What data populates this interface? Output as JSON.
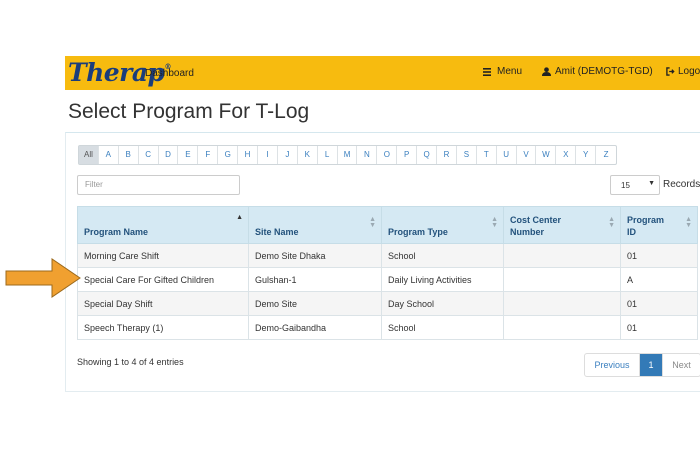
{
  "header": {
    "logo": "Therap",
    "logo_reg": "®",
    "dashboard_label": "Dashboard",
    "menu_label": "Menu",
    "user_label": "Amit (DEMOTG-TGD)",
    "logout_label": "Logo"
  },
  "page": {
    "title": "Select Program For T-Log"
  },
  "alphabet": [
    "All",
    "A",
    "B",
    "C",
    "D",
    "E",
    "F",
    "G",
    "H",
    "I",
    "J",
    "K",
    "L",
    "M",
    "N",
    "O",
    "P",
    "Q",
    "R",
    "S",
    "T",
    "U",
    "V",
    "W",
    "X",
    "Y",
    "Z"
  ],
  "filter": {
    "placeholder": "Filter"
  },
  "records": {
    "value": "15",
    "label": "Records"
  },
  "table": {
    "headers": [
      {
        "line1": "",
        "line2": "Program Name"
      },
      {
        "line1": "",
        "line2": "Site Name"
      },
      {
        "line1": "",
        "line2": "Program Type"
      },
      {
        "line1": "Cost Center",
        "line2": "Number"
      },
      {
        "line1": "Program",
        "line2": "ID"
      }
    ],
    "rows": [
      [
        "Morning Care Shift",
        "Demo Site Dhaka",
        "School",
        "",
        "01"
      ],
      [
        "Special Care For Gifted Children",
        "Gulshan-1",
        "Daily Living Activities",
        "",
        "A"
      ],
      [
        "Special Day Shift",
        "Demo Site",
        "Day School",
        "",
        "01"
      ],
      [
        "Speech Therapy (1)",
        "Demo-Gaibandha",
        "School",
        "",
        "01"
      ]
    ]
  },
  "footer": {
    "info": "Showing 1 to 4 of 4 entries",
    "prev_label": "Previous",
    "current_page": "1",
    "next_label": "Next"
  },
  "colors": {
    "navbar": "#f7bb0f",
    "accent": "#337ab7",
    "arrow": "#f0a030"
  }
}
